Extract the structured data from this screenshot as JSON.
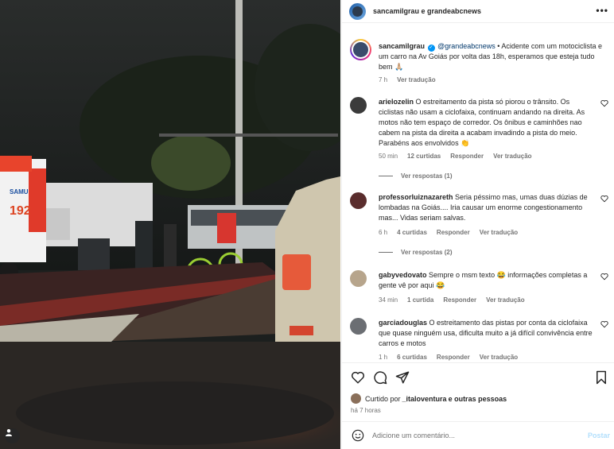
{
  "header": {
    "title": "sancamilgrau e grandeabcnews",
    "more_icon": "more-horizontal-icon"
  },
  "caption": {
    "username": "sancamilgrau",
    "mention": "@grandeabcnews",
    "text": " • Acidente com um motociclista e um carro na Av Goiás por volta das 18h, esperamos que esteja tudo bem 🙏🏼",
    "time": "7 h",
    "translate": "Ver tradução"
  },
  "comments": [
    {
      "username": "arielozelin",
      "text": "O estreitamento da pista só piorou o trânsito. Os ciclistas não usam a ciclofaixa, continuam andando na direita. As motos não tem espaço de corredor. Os ônibus e caminhões nao cabem na pista da direita a acabam invadindo a pista do meio. Parabéns aos envolvidos 👏",
      "time": "50 min",
      "likes": "12 curtidas",
      "reply": "Responder",
      "translate": "Ver tradução",
      "replies": "Ver respostas (1)",
      "avatar_color": "#3b3b3b"
    },
    {
      "username": "professorluiznazareth",
      "text": "Seria péssimo mas, umas duas dúzias de lombadas na Goiás.... Iria causar um enorme congestionamento mas... Vidas seriam salvas.",
      "time": "6 h",
      "likes": "4 curtidas",
      "reply": "Responder",
      "translate": "Ver tradução",
      "replies": "Ver respostas (2)",
      "avatar_color": "#5a2d2d"
    },
    {
      "username": "gabyvedovato",
      "text": "Sempre o msm texto 😂 informações completas a gente vê por aqui 😂",
      "time": "34 min",
      "likes": "1 curtida",
      "reply": "Responder",
      "translate": "Ver tradução",
      "replies": "",
      "avatar_color": "#b7a58c"
    },
    {
      "username": "garciadouglas",
      "text": "O estreitamento das pistas por conta da ciclofaixa que quase ninguém usa, dificulta muito a já difícil convivência entre carros e motos",
      "time": "1 h",
      "likes": "6 curtidas",
      "reply": "Responder",
      "translate": "Ver tradução",
      "replies": "",
      "avatar_color": "#6b6e73"
    }
  ],
  "actions": {
    "like_icon": "heart-icon",
    "comment_icon": "comment-icon",
    "share_icon": "share-icon",
    "save_icon": "bookmark-icon"
  },
  "liked_by": {
    "prefix": "Curtido por ",
    "user": "_italoventura",
    "suffix": " e outras pessoas"
  },
  "time_ago": "há 7 horas",
  "add_comment": {
    "placeholder": "Adicione um comentário...",
    "post_label": "Postar"
  },
  "photo": {
    "ambulance_number": "192",
    "ambulance_label": "SAMU"
  },
  "colors": {
    "link": "#00376b",
    "verified": "#0095f6",
    "secondary_text": "#737373",
    "post_disabled": "#b2dffc"
  }
}
